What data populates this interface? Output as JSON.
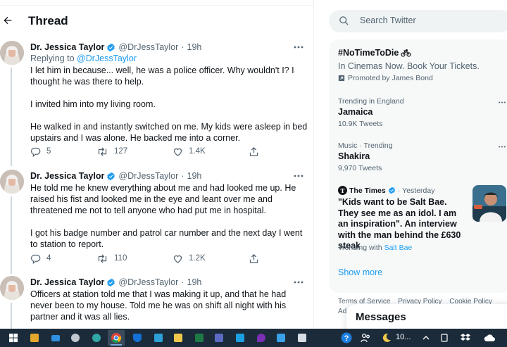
{
  "header": {
    "title": "Thread"
  },
  "tweets": [
    {
      "name": "Dr. Jessica Taylor",
      "handle": "@DrJessTaylor",
      "time": "19h",
      "replying_prefix": "Replying to ",
      "replying_to": "@DrJessTaylor",
      "paragraphs": [
        "I let him in because... well, he was a police officer. Why wouldn't I? I thought he was there to help.",
        "I invited him into my living room.",
        "He walked in and instantly switched on me. My kids were asleep in bed upstairs and I was alone. He backed me into a corner."
      ],
      "replies": "5",
      "retweets": "127",
      "likes": "1.4K"
    },
    {
      "name": "Dr. Jessica Taylor",
      "handle": "@DrJessTaylor",
      "time": "19h",
      "paragraphs": [
        "He told me he knew everything about me and had looked me up. He raised his fist and looked me in the eye and leant over me and threatened me not to tell anyone who had put me in hospital.",
        "I got his badge number and patrol car number and the next day I went to station to report."
      ],
      "replies": "4",
      "retweets": "110",
      "likes": "1.2K"
    },
    {
      "name": "Dr. Jessica Taylor",
      "handle": "@DrJessTaylor",
      "time": "19h",
      "paragraphs": [
        "Officers at station told me that I was making it up, and that he had never been to my house. Told me he was on shift all night with his partner and it was all lies."
      ]
    }
  ],
  "search": {
    "placeholder": "Search Twitter"
  },
  "trends": {
    "promoted": {
      "tag": "#NoTimeToDie",
      "text": "In Cinemas Now. Book Your Tickets.",
      "by": "Promoted by James Bond"
    },
    "items": [
      {
        "context": "Trending in England",
        "name": "Jamaica",
        "count": "10.9K Tweets"
      },
      {
        "context": "Music · Trending",
        "name": "Shakira",
        "count": "9,970 Tweets"
      }
    ],
    "news": {
      "logo_letter": "T",
      "source": "The Times",
      "time": "Yesterday",
      "title": "\"Kids want to be Salt Bae. They see me as an idol. I am an inspiration\". An interview with the man behind the £630 steak",
      "trending_prefix": "Trending with ",
      "trending_with": "Salt Bae"
    },
    "show_more": "Show more"
  },
  "footer": {
    "links": [
      "Terms of Service",
      "Privacy Policy",
      "Cookie Policy"
    ],
    "second_line": "Ad"
  },
  "messages": {
    "label": "Messages"
  },
  "taskbar": {
    "temperature": "10...",
    "icons": [
      "start-icon",
      "store-icon",
      "mail-icon",
      "weather-icon",
      "edge-icon",
      "chrome-icon",
      "defender-icon",
      "app-icon",
      "notes-icon",
      "excel-icon",
      "files-icon",
      "teams-icon",
      "skype-icon",
      "tool-icon",
      "photos-icon"
    ]
  },
  "colors": {
    "accent": "#1d9bf0",
    "text": "#0f1419",
    "secondary": "#536471",
    "panel": "#f7f9f9"
  }
}
